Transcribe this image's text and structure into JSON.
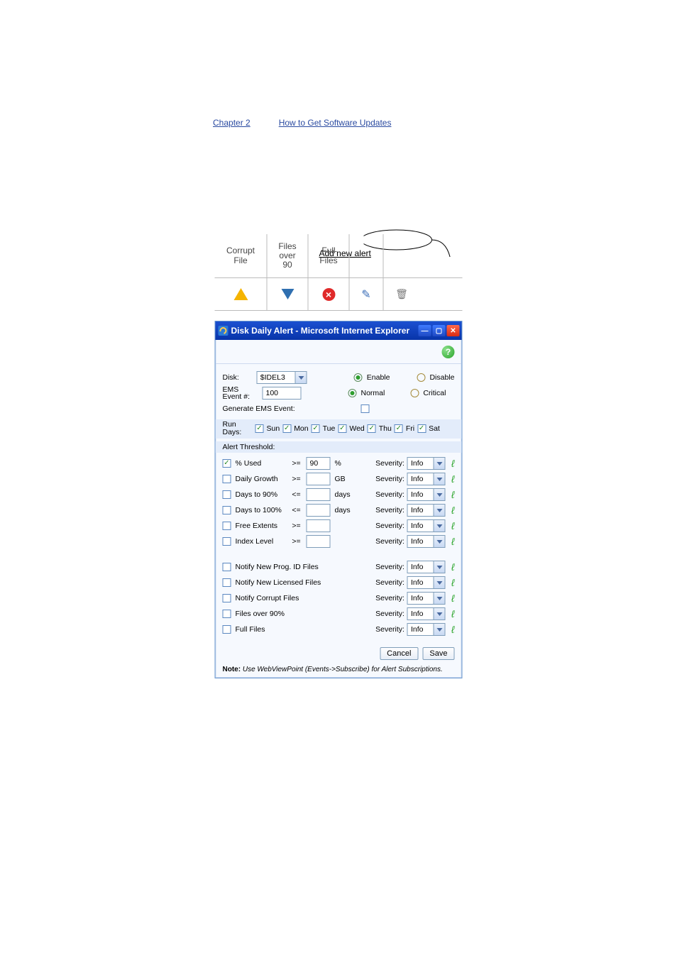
{
  "links": {
    "left": "Chapter 2",
    "right": "How to Get Software Updates"
  },
  "callout": "Add new alert",
  "columns": {
    "corrupt": {
      "l1": "Corrupt",
      "l2": "File"
    },
    "over90": {
      "l1": "Files",
      "l2": "over",
      "l3": "90"
    },
    "full": {
      "l1": "Full",
      "l2": "Files"
    }
  },
  "dialog": {
    "title": "Disk Daily Alert - Microsoft Internet Explorer",
    "disk_label": "Disk:",
    "disk_value": "$IDEL3",
    "ems_label": "EMS Event #:",
    "ems_value": "100",
    "enable": "Enable",
    "disable": "Disable",
    "normal": "Normal",
    "critical": "Critical",
    "gen_label": "Generate EMS Event:",
    "run_label": "Run Days:",
    "days": [
      "Sun",
      "Mon",
      "Tue",
      "Wed",
      "Thu",
      "Fri",
      "Sat"
    ],
    "thresh_header": "Alert Threshold:",
    "thresholds": [
      {
        "label": "% Used",
        "checked": true,
        "op": ">=",
        "value": "90",
        "unit": "%",
        "sev": "Info"
      },
      {
        "label": "Daily Growth",
        "checked": false,
        "op": ">=",
        "value": "",
        "unit": "GB",
        "sev": "Info"
      },
      {
        "label": "Days to 90%",
        "checked": false,
        "op": "<=",
        "value": "",
        "unit": "days",
        "sev": "Info"
      },
      {
        "label": "Days to 100%",
        "checked": false,
        "op": "<=",
        "value": "",
        "unit": "days",
        "sev": "Info"
      },
      {
        "label": "Free Extents",
        "checked": false,
        "op": ">=",
        "value": "",
        "unit": "",
        "sev": "Info"
      },
      {
        "label": "Index Level",
        "checked": false,
        "op": ">=",
        "value": "",
        "unit": "",
        "sev": "Info"
      }
    ],
    "notifies": [
      {
        "label": "Notify New Prog. ID Files",
        "sev": "Info"
      },
      {
        "label": "Notify New Licensed Files",
        "sev": "Info"
      },
      {
        "label": "Notify Corrupt Files",
        "sev": "Info"
      },
      {
        "label": "Files over 90%",
        "sev": "Info"
      },
      {
        "label": "Full Files",
        "sev": "Info"
      }
    ],
    "cancel": "Cancel",
    "save": "Save",
    "note_bold": "Note:",
    "note_rest": " Use WebViewPoint (Events->Subscribe) for Alert Subscriptions."
  }
}
